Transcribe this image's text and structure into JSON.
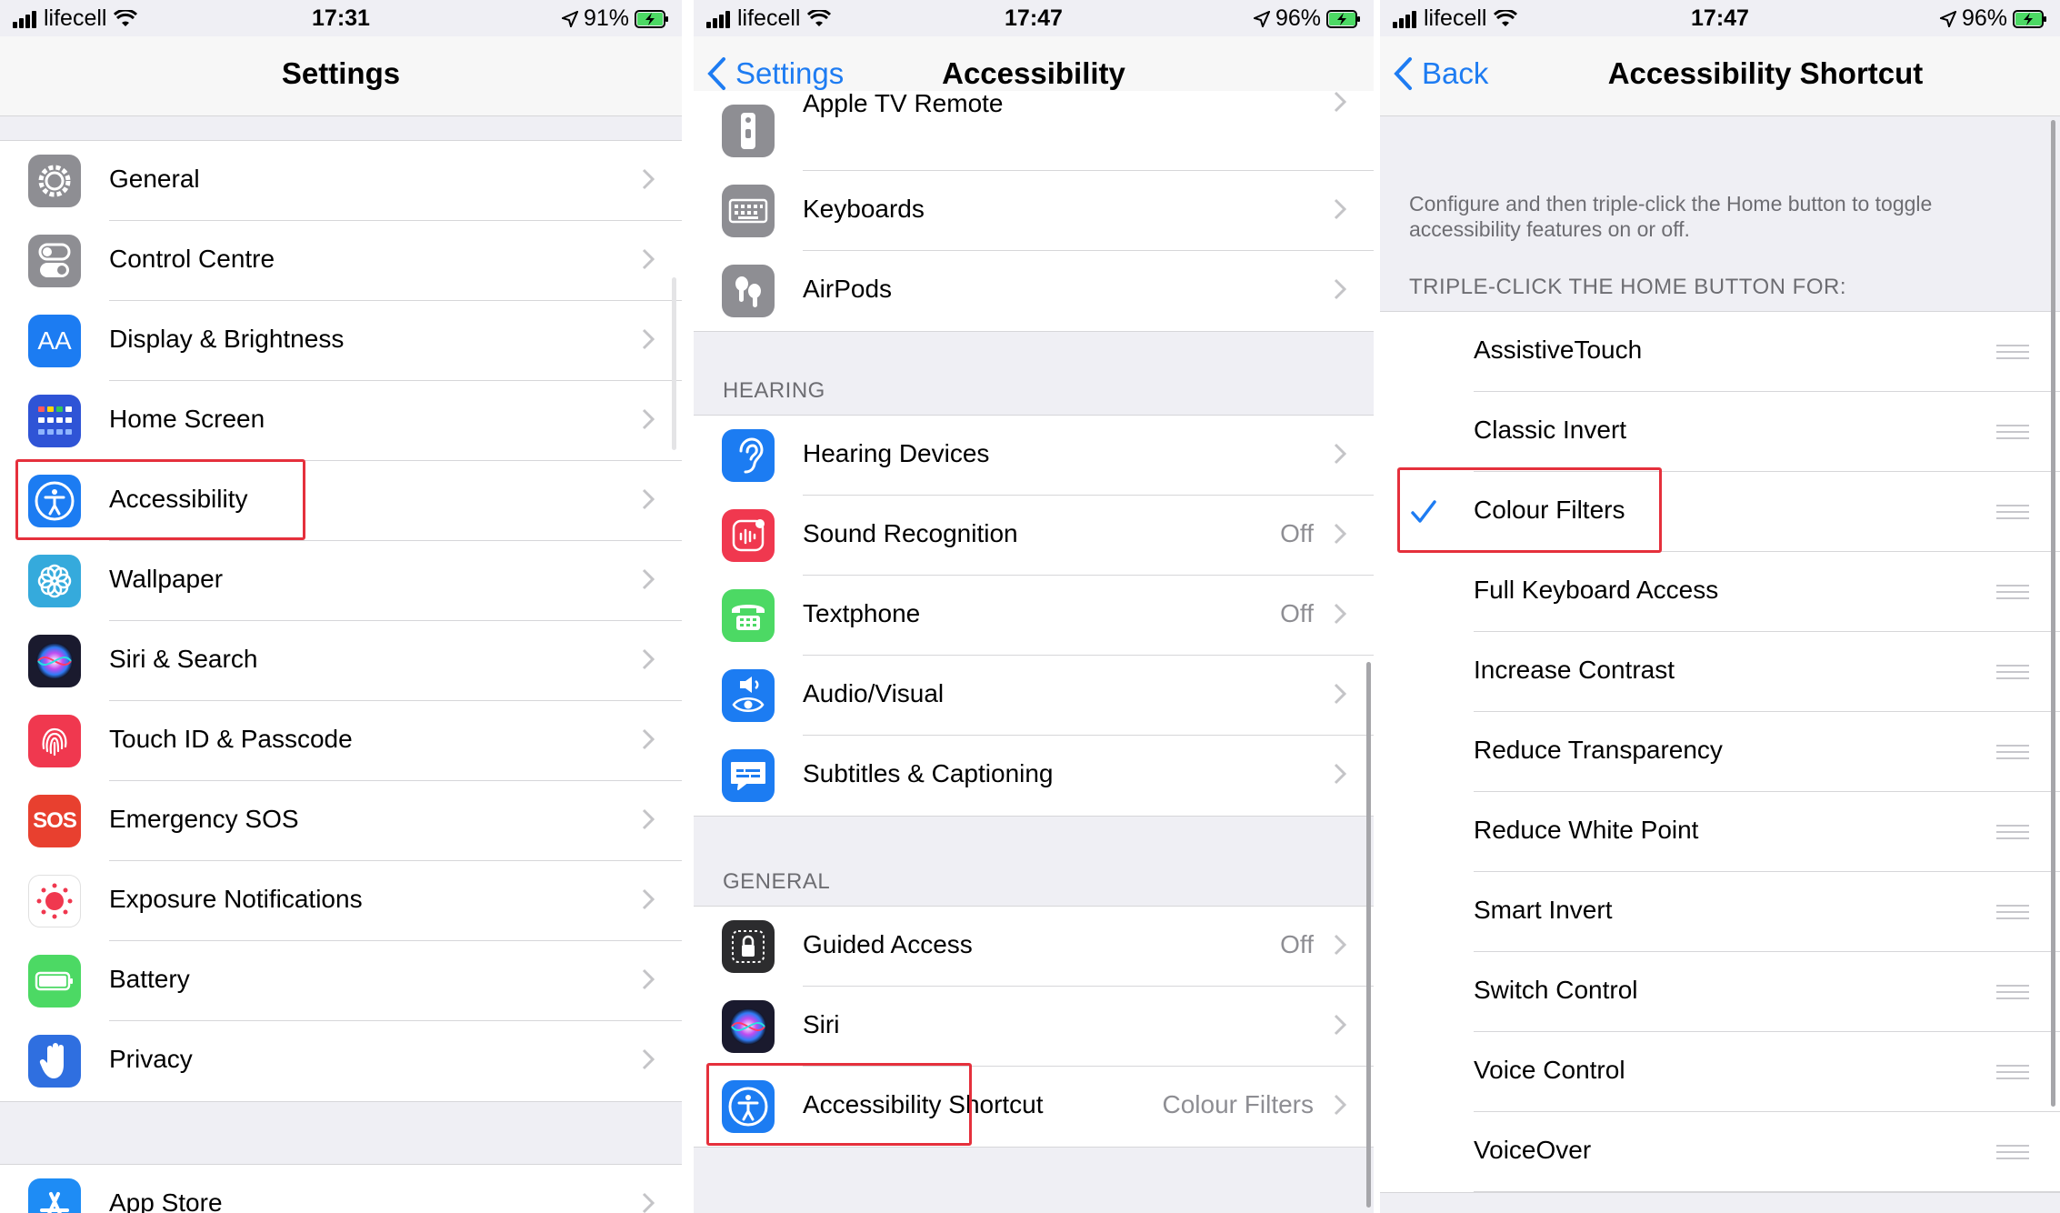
{
  "panels": [
    {
      "status": {
        "carrier": "lifecell",
        "time": "17:31",
        "battery": "91%"
      },
      "nav": {
        "title": "Settings"
      },
      "rows": [
        {
          "label": "General",
          "icon": "gear-icon"
        },
        {
          "label": "Control Centre",
          "icon": "toggles-icon"
        },
        {
          "label": "Display & Brightness",
          "icon": "text-size-icon",
          "icon_text": "AA"
        },
        {
          "label": "Home Screen",
          "icon": "app-grid-icon"
        },
        {
          "label": "Accessibility",
          "icon": "accessibility-person-icon"
        },
        {
          "label": "Wallpaper",
          "icon": "flower-icon"
        },
        {
          "label": "Siri & Search",
          "icon": "siri-icon"
        },
        {
          "label": "Touch ID & Passcode",
          "icon": "fingerprint-icon"
        },
        {
          "label": "Emergency SOS",
          "icon": "sos-icon",
          "icon_text": "SOS"
        },
        {
          "label": "Exposure Notifications",
          "icon": "exposure-icon"
        },
        {
          "label": "Battery",
          "icon": "battery-icon"
        },
        {
          "label": "Privacy",
          "icon": "hand-icon"
        },
        {
          "label": "App Store",
          "icon": "app-store-icon"
        }
      ]
    },
    {
      "status": {
        "carrier": "lifecell",
        "time": "17:47",
        "battery": "96%"
      },
      "nav": {
        "title": "Accessibility",
        "back": "Settings"
      },
      "rows_top": [
        {
          "label": "Apple TV Remote",
          "icon": "remote-icon"
        },
        {
          "label": "Keyboards",
          "icon": "keyboard-icon"
        },
        {
          "label": "AirPods",
          "icon": "airpods-icon"
        }
      ],
      "hearing_header": "HEARING",
      "rows_hearing": [
        {
          "label": "Hearing Devices",
          "icon": "ear-icon"
        },
        {
          "label": "Sound Recognition",
          "value": "Off",
          "icon": "sound-recognition-icon"
        },
        {
          "label": "Textphone",
          "value": "Off",
          "icon": "textphone-icon"
        },
        {
          "label": "Audio/Visual",
          "icon": "audio-visual-icon"
        },
        {
          "label": "Subtitles & Captioning",
          "icon": "caption-bubble-icon"
        }
      ],
      "general_header": "GENERAL",
      "rows_general": [
        {
          "label": "Guided Access",
          "value": "Off",
          "icon": "lock-icon"
        },
        {
          "label": "Siri",
          "icon": "siri-icon"
        },
        {
          "label": "Accessibility Shortcut",
          "value": "Colour Filters",
          "icon": "accessibility-person-icon"
        }
      ]
    },
    {
      "status": {
        "carrier": "lifecell",
        "time": "17:47",
        "battery": "96%"
      },
      "nav": {
        "title": "Accessibility Shortcut",
        "back": "Back"
      },
      "description": "Configure and then triple-click the Home button to toggle accessibility features on or off.",
      "list_header": "TRIPLE-CLICK THE HOME BUTTON FOR:",
      "options": [
        {
          "label": "AssistiveTouch",
          "checked": false
        },
        {
          "label": "Classic Invert",
          "checked": false
        },
        {
          "label": "Colour Filters",
          "checked": true
        },
        {
          "label": "Full Keyboard Access",
          "checked": false
        },
        {
          "label": "Increase Contrast",
          "checked": false
        },
        {
          "label": "Reduce Transparency",
          "checked": false
        },
        {
          "label": "Reduce White Point",
          "checked": false
        },
        {
          "label": "Smart Invert",
          "checked": false
        },
        {
          "label": "Switch Control",
          "checked": false
        },
        {
          "label": "Voice Control",
          "checked": false
        },
        {
          "label": "VoiceOver",
          "checked": false
        }
      ]
    }
  ],
  "colors": {
    "accent_blue": "#1e7cf2",
    "highlight_red": "#e5303c",
    "battery_green": "#4cd964"
  }
}
